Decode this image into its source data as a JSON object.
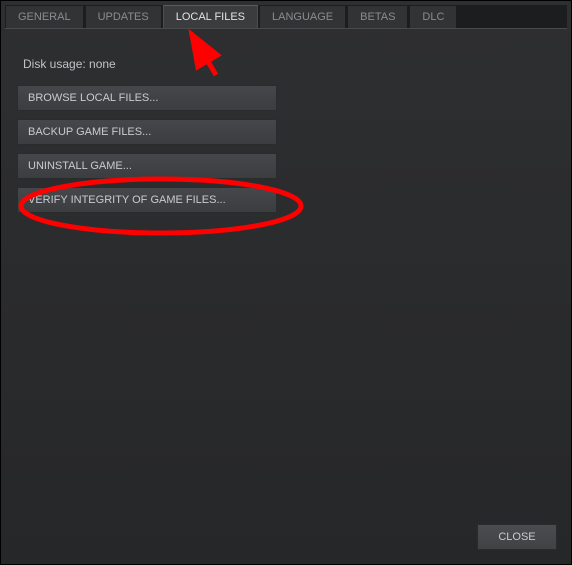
{
  "tabs": [
    {
      "label": "GENERAL",
      "active": false
    },
    {
      "label": "UPDATES",
      "active": false
    },
    {
      "label": "LOCAL FILES",
      "active": true
    },
    {
      "label": "LANGUAGE",
      "active": false
    },
    {
      "label": "BETAS",
      "active": false
    },
    {
      "label": "DLC",
      "active": false
    }
  ],
  "disk_usage_label": "Disk usage: none",
  "actions": {
    "browse": "BROWSE LOCAL FILES...",
    "backup": "BACKUP GAME FILES...",
    "uninstall": "UNINSTALL GAME...",
    "verify": "VERIFY INTEGRITY OF GAME FILES..."
  },
  "close_label": "CLOSE",
  "annotation": {
    "color": "#ff0000"
  }
}
